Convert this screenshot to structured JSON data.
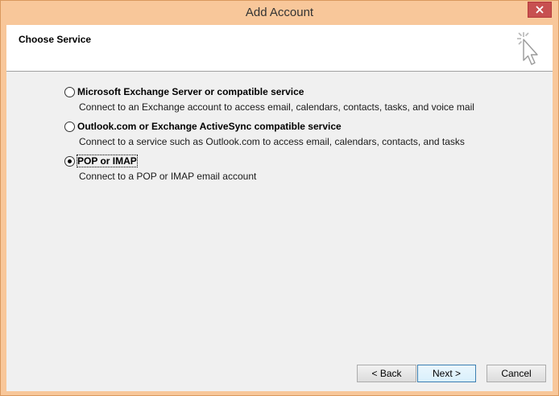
{
  "window": {
    "title": "Add Account"
  },
  "header": {
    "title": "Choose Service",
    "icon": "wizard-cursor-icon"
  },
  "options": [
    {
      "label": "Microsoft Exchange Server or compatible service",
      "description": "Connect to an Exchange account to access email, calendars, contacts, tasks, and voice mail",
      "selected": false
    },
    {
      "label": "Outlook.com or Exchange ActiveSync compatible service",
      "description": "Connect to a service such as Outlook.com to access email, calendars, contacts, and tasks",
      "selected": false
    },
    {
      "label": "POP or IMAP",
      "description": "Connect to a POP or IMAP email account",
      "selected": true
    }
  ],
  "buttons": {
    "back": "< Back",
    "next": "Next >",
    "cancel": "Cancel"
  },
  "colors": {
    "titlebar": "#f8c79a",
    "close": "#c75050",
    "client": "#f0f0f0",
    "header": "#ffffff"
  }
}
